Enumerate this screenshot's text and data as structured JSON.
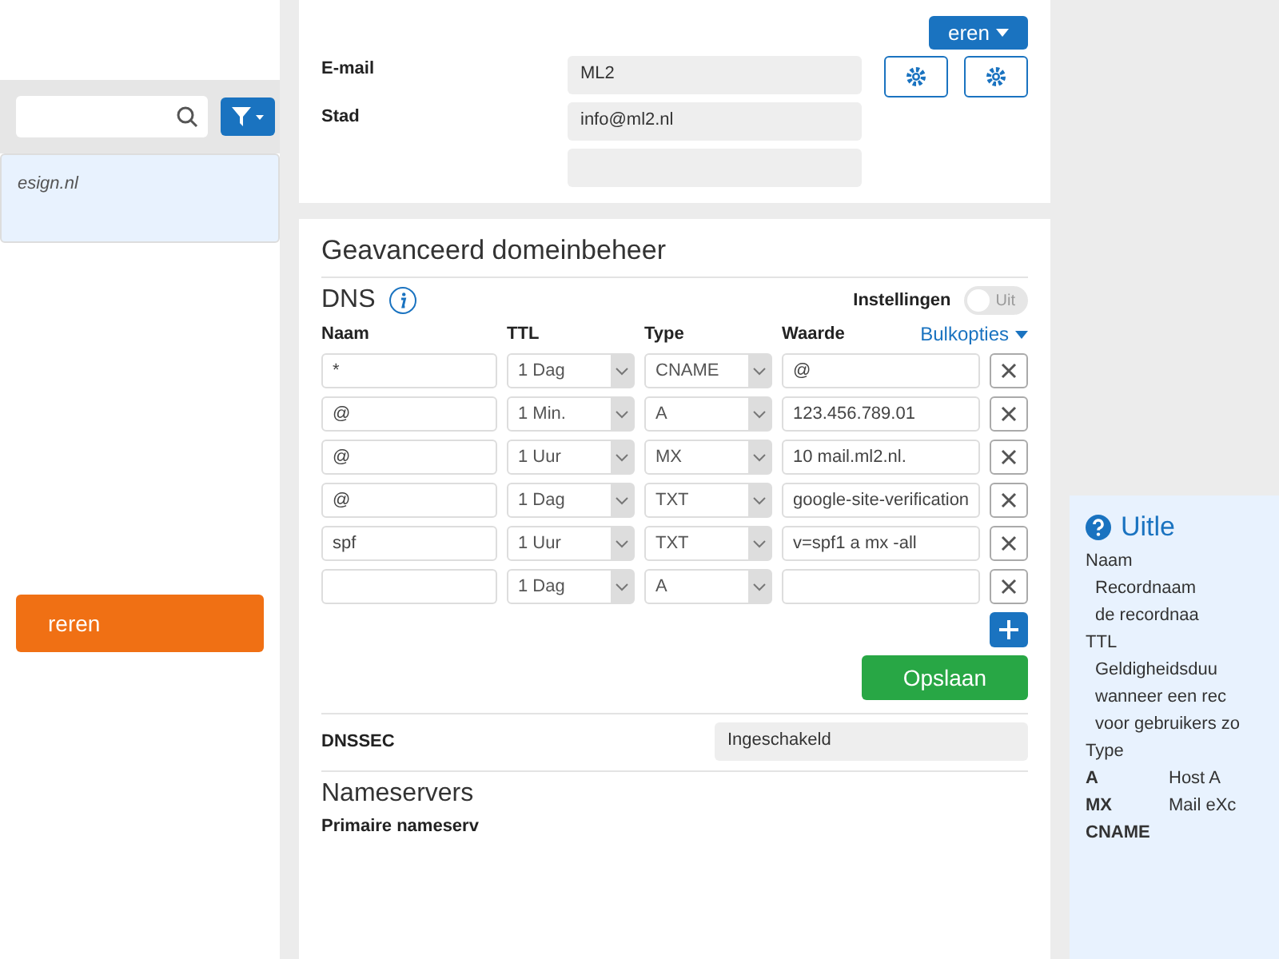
{
  "sidebar": {
    "items": [
      {
        "label": "esign.nl",
        "selected": true
      }
    ],
    "action_button": "reren"
  },
  "top_button": "eren",
  "contact": {
    "fields": [
      {
        "label": "E-mail",
        "value": "ML2"
      },
      {
        "label": "Stad",
        "value": "info@ml2.nl"
      }
    ]
  },
  "advanced": {
    "title": "Geavanceerd domeinbeheer",
    "dns_title": "DNS",
    "settings_label": "Instellingen",
    "toggle": {
      "label": "Uit",
      "on": false
    },
    "bulk": "Bulkopties",
    "columns": [
      "Naam",
      "TTL",
      "Type",
      "Waarde"
    ],
    "records": [
      {
        "name": "*",
        "ttl": "1 Dag",
        "type": "CNAME",
        "value": "@"
      },
      {
        "name": "@",
        "ttl": "1 Min.",
        "type": "A",
        "value": "123.456.789.01"
      },
      {
        "name": "@",
        "ttl": "1 Uur",
        "type": "MX",
        "value": "10 mail.ml2.nl."
      },
      {
        "name": "@",
        "ttl": "1 Dag",
        "type": "TXT",
        "value": "google-site-verification"
      },
      {
        "name": "spf",
        "ttl": "1 Uur",
        "type": "TXT",
        "value": "v=spf1 a mx -all"
      },
      {
        "ttl": "1 Dag",
        "type": "A"
      }
    ],
    "save": "Opslaan",
    "dnssec_label": "DNSSEC",
    "dnssec_value": "Ingeschakeld",
    "ns_title": "Nameservers",
    "ns_primary": "Primaire nameserv"
  },
  "help": {
    "title": "Uitle",
    "lines": [
      {
        "kind": "term",
        "text": "Naam"
      },
      {
        "kind": "desc",
        "text": "Recordnaam"
      },
      {
        "kind": "desc",
        "text": "de recordnaa"
      },
      {
        "kind": "term",
        "text": "TTL"
      },
      {
        "kind": "desc",
        "text": "Geldigheidsduu"
      },
      {
        "kind": "desc",
        "text": "wanneer een rec"
      },
      {
        "kind": "desc",
        "text": "voor gebruikers zo"
      },
      {
        "kind": "term",
        "text": "Type"
      }
    ],
    "types": [
      {
        "code": "A",
        "text": "Host A"
      },
      {
        "code": "MX",
        "text": "Mail eXc"
      },
      {
        "code": "CNAME"
      }
    ]
  }
}
